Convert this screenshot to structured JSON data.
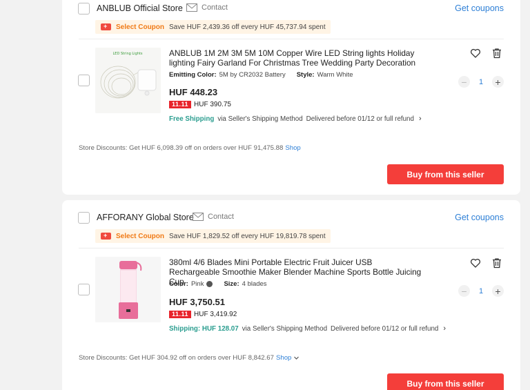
{
  "stores": [
    {
      "name": "ANBLUB Official Store",
      "contact_label": "Contact",
      "get_coupons_label": "Get coupons",
      "coupon": {
        "select_label": "Select Coupon",
        "save_text": "Save HUF 2,439.36 off every HUF 45,737.94 spent"
      },
      "item": {
        "title": "ANBLUB 1M 2M 3M 5M 10M Copper Wire LED String lights Holiday lighting Fairy Garland For Christmas Tree Wedding Party Decoration",
        "image_label": "LED String Lights",
        "spec1_key": "Emitting Color:",
        "spec1_val": "5M by CR2032 Battery",
        "spec2_key": "Style:",
        "spec2_val": "Warm White",
        "price": "HUF 448.23",
        "promo_badge": "11.11",
        "promo_price": "HUF 390.75",
        "shipping_lead": "Free Shipping",
        "shipping_method": "via Seller's Shipping Method",
        "delivery": "Delivered before 01/12 or full refund",
        "quantity": "1"
      },
      "store_discount_text": "Store Discounts: Get HUF 6,098.39 off on orders over HUF 91,475.88",
      "shop_label": "Shop",
      "buy_label": "Buy from this seller"
    },
    {
      "name": "AFFORANY Global Store",
      "contact_label": "Contact",
      "get_coupons_label": "Get coupons",
      "coupon": {
        "select_label": "Select Coupon",
        "save_text": "Save HUF 1,829.52 off every HUF 19,819.78 spent"
      },
      "item": {
        "title": "380ml 4/6 Blades Mini Portable Electric Fruit Juicer USB Rechargeable Smoothie Maker Blender Machine Sports Bottle Juicing Cup",
        "spec1_key": "Color:",
        "spec1_val": "Pink",
        "spec2_key": "Size:",
        "spec2_val": "4 blades",
        "price": "HUF 3,750.51",
        "promo_badge": "11.11",
        "promo_price": "HUF 3,419.92",
        "shipping_lead": "Shipping: HUF 128.07",
        "shipping_method": "via Seller's Shipping Method",
        "delivery": "Delivered before 01/12 or full refund",
        "quantity": "1"
      },
      "store_discount_text": "Store Discounts: Get HUF 304.92 off on orders over HUF 8,842.67",
      "shop_label": "Shop",
      "buy_label": "Buy from this seller"
    }
  ],
  "icons": {
    "contact": "mail-icon",
    "wishlist": "heart-icon",
    "delete": "trash-icon",
    "coupon": "ticket-icon",
    "chevron": "chevron-right-icon",
    "shop_chevron": "chevron-down-icon"
  },
  "colors": {
    "accent_blue": "#2d7fd6",
    "buy_red": "#f43e3a",
    "coupon_orange": "#f07a16",
    "free_shipping_teal": "#2a9d8f",
    "promo_red": "#e8242b"
  }
}
